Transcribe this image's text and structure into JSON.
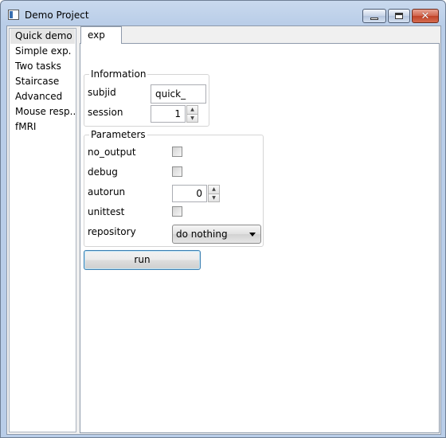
{
  "window": {
    "title": "Demo Project",
    "controls": [
      "minimize-icon",
      "maximize-icon",
      "close-icon"
    ],
    "close_glyph": "✕"
  },
  "sidebar": {
    "items": [
      {
        "label": "Quick demo",
        "selected": true
      },
      {
        "label": "Simple exp."
      },
      {
        "label": "Two tasks"
      },
      {
        "label": "Staircase"
      },
      {
        "label": "Advanced"
      },
      {
        "label": "Mouse resp..."
      },
      {
        "label": "fMRI"
      }
    ]
  },
  "tabs": [
    {
      "label": "exp",
      "selected": true
    }
  ],
  "information": {
    "title": "Information",
    "subjid_label": "subjid",
    "subjid_value": "quick_",
    "session_label": "session",
    "session_value": "1"
  },
  "parameters": {
    "title": "Parameters",
    "no_output_label": "no_output",
    "no_output_checked": false,
    "debug_label": "debug",
    "debug_checked": false,
    "autorun_label": "autorun",
    "autorun_value": "0",
    "unittest_label": "unittest",
    "unittest_checked": false,
    "repository_label": "repository",
    "repository_value": "do nothing"
  },
  "actions": {
    "run_label": "run"
  },
  "spin_arrows": {
    "up": "▲",
    "down": "▼"
  }
}
